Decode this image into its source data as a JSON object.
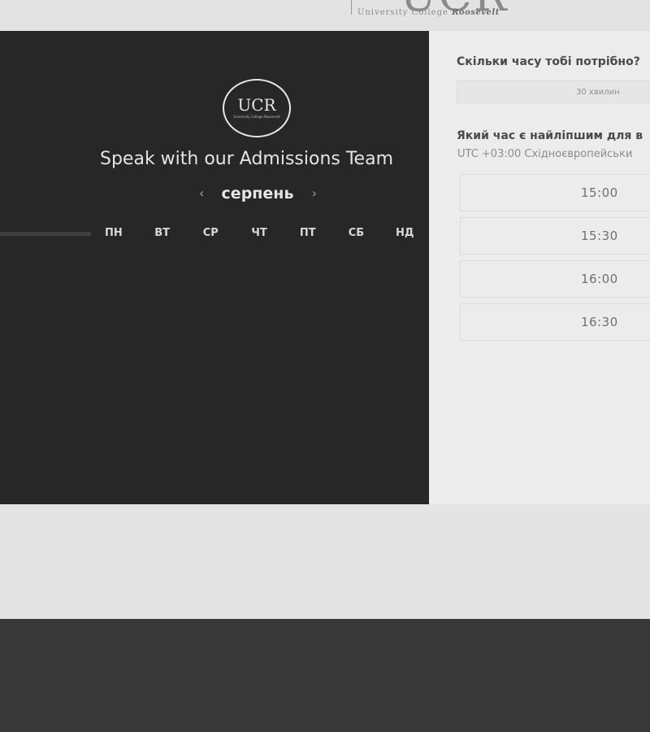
{
  "brand": {
    "letters": "UCR",
    "sub_text": "University College",
    "sub_italic": "Roosevelt"
  },
  "widget": {
    "logo_text": "UCR",
    "logo_sub": "University College Roosevelt",
    "title": "Speak with our Admissions Team",
    "month": "серпень",
    "prev_arrow": "‹",
    "next_arrow": "›",
    "weekdays": [
      "ПН",
      "ВТ",
      "СР",
      "ЧТ",
      "ПТ",
      "СБ",
      "НД"
    ]
  },
  "sidebar": {
    "duration_question": "Скільки часу тобі потрібно?",
    "duration_value": "30 хвилин",
    "time_question": "Який час є найліпшим для в",
    "timezone": "UTC +03:00 Східноєвропейськи",
    "slots": [
      "15:00",
      "15:30",
      "16:00",
      "16:30"
    ]
  }
}
